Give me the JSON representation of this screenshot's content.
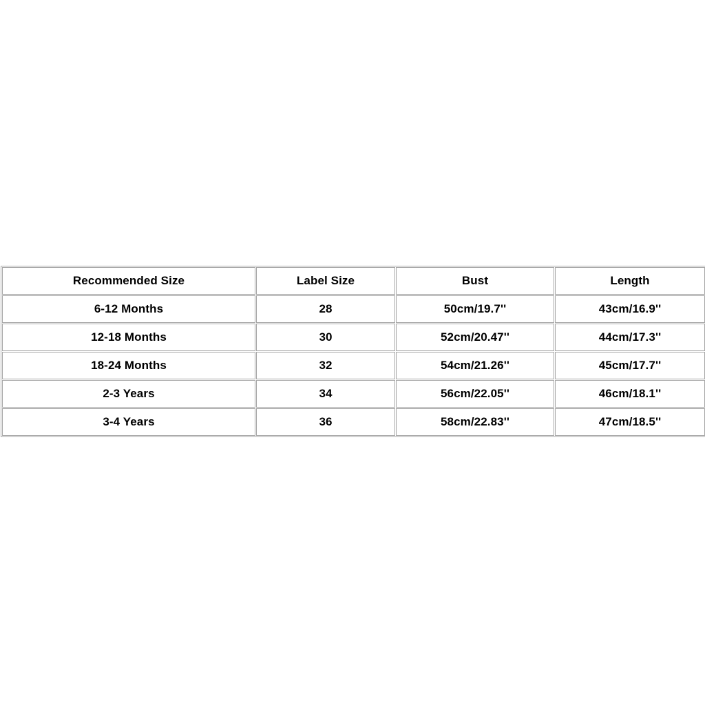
{
  "page": {
    "background_color": "#ffffff",
    "text_color": "#000000",
    "border_color": "#a6a6a6"
  },
  "table": {
    "name": "size-chart",
    "columns": [
      {
        "key": "recommended_size",
        "header": "Recommended Size"
      },
      {
        "key": "label_size",
        "header": "Label Size"
      },
      {
        "key": "bust",
        "header": "Bust"
      },
      {
        "key": "length",
        "header": "Length"
      }
    ],
    "headers": {
      "recommended_size": "Recommended Size",
      "label_size": "Label Size",
      "bust": "Bust",
      "length": "Length"
    },
    "rows": [
      {
        "recommended_size": "6-12 Months",
        "label_size": "28",
        "bust": "50cm/19.7''",
        "length": "43cm/16.9''"
      },
      {
        "recommended_size": "12-18 Months",
        "label_size": "30",
        "bust": "52cm/20.47''",
        "length": "44cm/17.3''"
      },
      {
        "recommended_size": "18-24 Months",
        "label_size": "32",
        "bust": "54cm/21.26''",
        "length": "45cm/17.7''"
      },
      {
        "recommended_size": "2-3 Years",
        "label_size": "34",
        "bust": "56cm/22.05''",
        "length": "46cm/18.1''"
      },
      {
        "recommended_size": "3-4 Years",
        "label_size": "36",
        "bust": "58cm/22.83''",
        "length": "47cm/18.5''"
      }
    ]
  }
}
